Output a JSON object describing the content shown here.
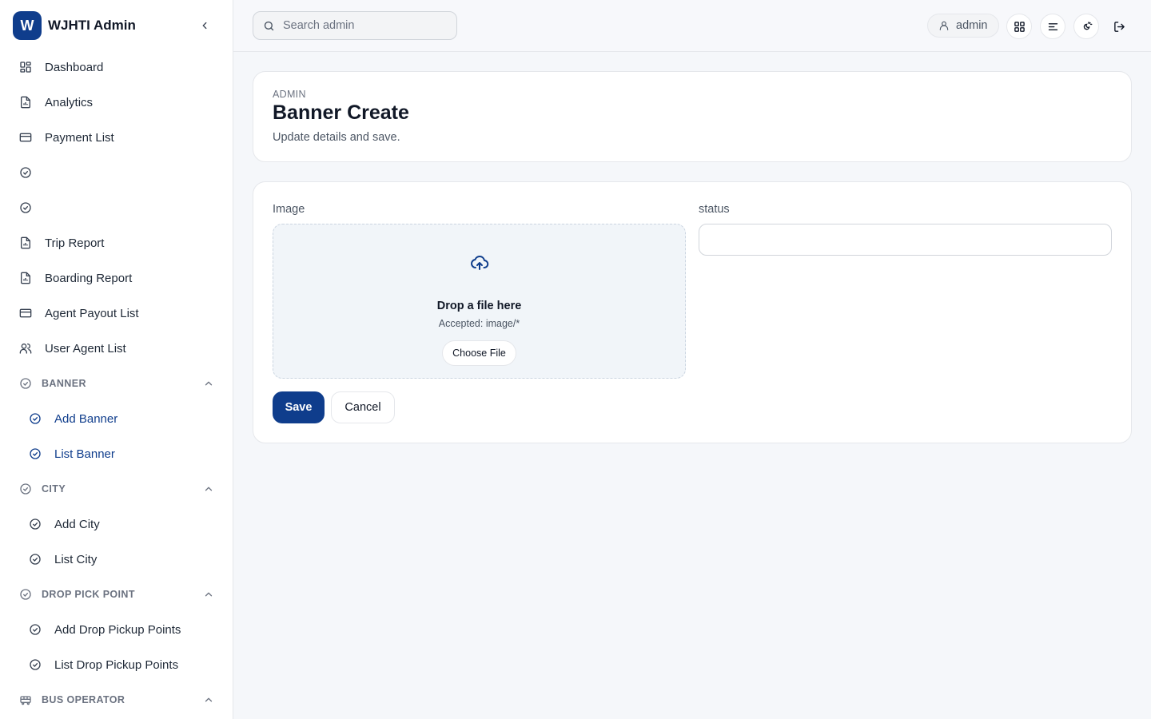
{
  "brand": {
    "logo_letter": "W",
    "name": "WJHTI Admin"
  },
  "sidebar": {
    "items": [
      {
        "label": "Dashboard",
        "icon": "grid-icon"
      },
      {
        "label": "Analytics",
        "icon": "report-icon"
      },
      {
        "label": "Payment List",
        "icon": "card-icon"
      },
      {
        "label": "",
        "icon": "check-circle-icon"
      },
      {
        "label": "",
        "icon": "check-circle-icon"
      },
      {
        "label": "Trip Report",
        "icon": "report-icon"
      },
      {
        "label": "Boarding Report",
        "icon": "report-icon"
      },
      {
        "label": "Agent Payout List",
        "icon": "card-icon"
      },
      {
        "label": "User Agent List",
        "icon": "users-icon"
      }
    ],
    "sections": [
      {
        "label": "BANNER",
        "items": [
          "Add Banner",
          "List Banner"
        ]
      },
      {
        "label": "CITY",
        "items": [
          "Add City",
          "List City"
        ]
      },
      {
        "label": "DROP PICK POINT",
        "items": [
          "Add Drop Pickup Points",
          "List Drop Pickup Points"
        ]
      },
      {
        "label": "BUS OPERATOR",
        "items": []
      }
    ]
  },
  "topbar": {
    "search_placeholder": "Search admin",
    "user_label": "admin"
  },
  "header": {
    "eyebrow": "ADMIN",
    "title": "Banner Create",
    "subtitle": "Update details and save."
  },
  "form": {
    "image_label": "Image",
    "status_label": "status",
    "status_value": "",
    "dropzone_title": "Drop a file here",
    "dropzone_accepted": "Accepted: image/*",
    "choose_file_label": "Choose File",
    "save_label": "Save",
    "cancel_label": "Cancel"
  },
  "colors": {
    "accent": "#0f3d8c",
    "background": "#f5f7fa"
  }
}
